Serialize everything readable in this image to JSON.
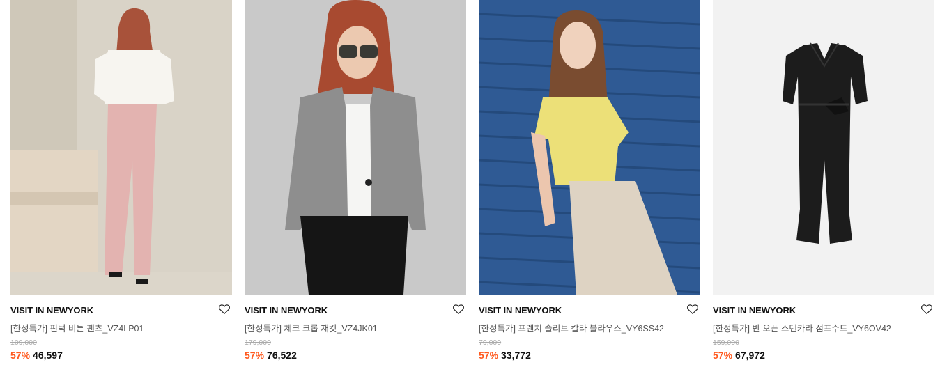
{
  "products": [
    {
      "brand": "VISIT IN NEWYORK",
      "name": "[한정특가] 핀턱 비튼 팬츠_VZ4LP01",
      "original_price": "109,000",
      "discount": "57%",
      "price": "46,597",
      "photo_bg": "#d9d3c7"
    },
    {
      "brand": "VISIT IN NEWYORK",
      "name": "[한정특가] 체크 크롭 재킷_VZ4JK01",
      "original_price": "179,000",
      "discount": "57%",
      "price": "76,522",
      "photo_bg": "#c9c9c9"
    },
    {
      "brand": "VISIT IN NEWYORK",
      "name": "[한정특가] 프렌치 슬리브 칼라 블라우스_VY6SS42",
      "original_price": "79,000",
      "discount": "57%",
      "price": "33,772",
      "photo_bg": "#2f5a94"
    },
    {
      "brand": "VISIT IN NEWYORK",
      "name": "[한정특가] 반 오픈 스탠카라 점프수트_VY6OV42",
      "original_price": "159,000",
      "discount": "57%",
      "price": "67,972",
      "photo_bg": "#f2f2f2"
    }
  ],
  "colors": {
    "discount": "#ff5a1f",
    "brand_text": "#111111",
    "name_text": "#555555",
    "original_price_text": "#aaaaaa"
  },
  "icons": {
    "wishlist": "heart-outline-icon"
  }
}
